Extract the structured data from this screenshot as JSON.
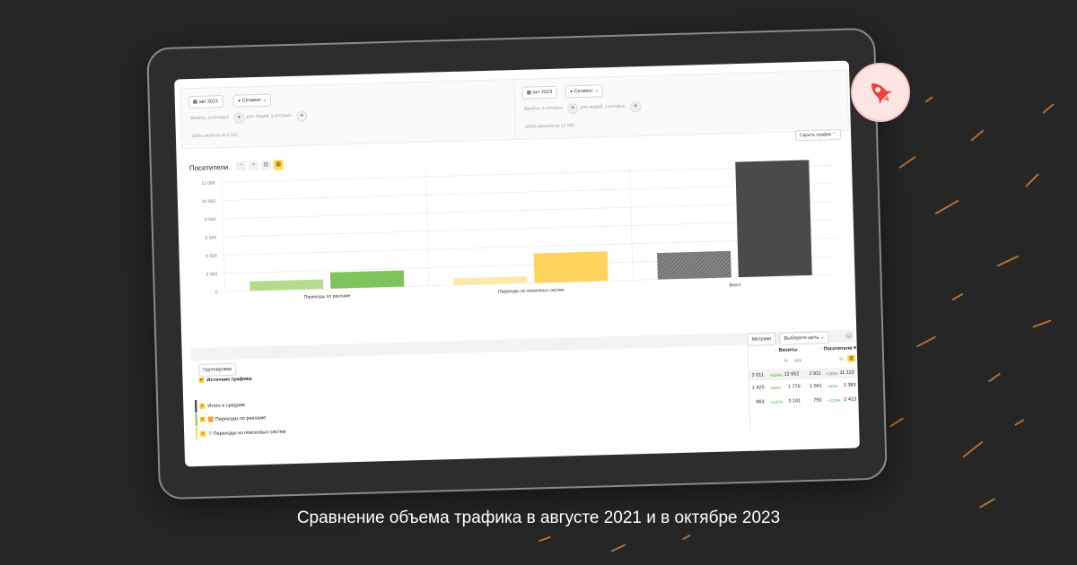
{
  "caption": "Сравнение объема трафика в августе 2021 и в октябре 2023",
  "segments": {
    "left": {
      "date": "авг 2021",
      "segment_label": "Сегмент",
      "visits_label": "Визиты, в которых",
      "people_label": "для людей, у которых",
      "percent_text": "100% визитов из 2 011"
    },
    "right": {
      "date": "окт 2023",
      "segment_label": "Сегмент",
      "visits_label": "Визиты, в которых",
      "people_label": "для людей, у которых",
      "percent_text": "100% визитов из 12 652"
    }
  },
  "chart_header": {
    "title": "Посетители",
    "hide_button": "Скрыть график"
  },
  "chart_data": {
    "type": "bar",
    "categories": [
      "Переходы по рекламе",
      "Переходы из поисковых систем",
      "Всего"
    ],
    "series": [
      {
        "values": [
          1041,
          750,
          2911
        ]
      },
      {
        "values": [
          1776,
          3241,
          12652
        ]
      }
    ],
    "ylim": [
      0,
      12000
    ],
    "yticks": [
      "0",
      "2 000",
      "4 000",
      "6 000",
      "8 000",
      "10 000",
      "12 000"
    ],
    "colors": {
      "ads_left": "#b5db8e",
      "ads_right": "#7fc45a",
      "search_left": "#fde9ab",
      "search_right": "#ffd45c",
      "total_left": "#777777",
      "total_right": "#4a4a4a"
    }
  },
  "table": {
    "metrics_button": "Метрики",
    "goal_select": "Выберите цель",
    "groupings_button": "Группировки",
    "col_visits": "Визиты",
    "col_visitors": "Посетители",
    "col_pct": "%",
    "col_abs": "abs",
    "source_header": "Источник трафика",
    "totals": {
      "visits_a": "2 011",
      "visits_pct": "+529%",
      "visits_b": "12 652",
      "visitors_a": "2 911",
      "visitors_pct": "+335%",
      "visitors_b": "11 122"
    },
    "rows": [
      {
        "label": "Итого и средние",
        "visits_a": "1 425",
        "visits_pct": "+25%",
        "visits_b": "1 776",
        "visitors_a": "1 041",
        "visitors_pct": "+33%",
        "visitors_b": "1 383"
      },
      {
        "label": "Переходы по рекламе",
        "visits_a": "963",
        "visits_pct": "+237%",
        "visits_b": "3 241",
        "visitors_a": "750",
        "visitors_pct": "+223%",
        "visitors_b": "2 413"
      },
      {
        "label": "Переходы из поисковых систем"
      }
    ]
  }
}
